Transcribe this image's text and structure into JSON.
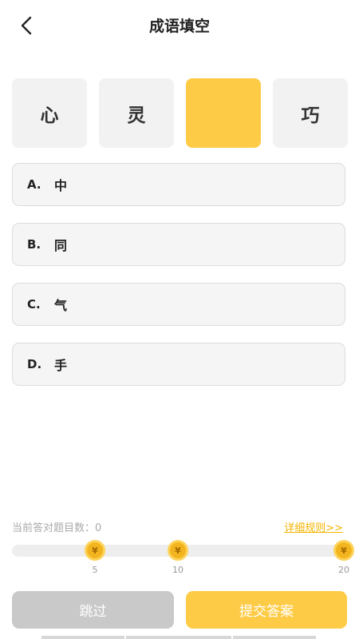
{
  "header": {
    "title": "成语填空",
    "back_icon": "chevron-left-icon"
  },
  "idiom": {
    "chars": [
      "心",
      "灵",
      "",
      "巧"
    ],
    "blank_color": "#fdcb46"
  },
  "options": [
    {
      "letter": "A.",
      "text": "中"
    },
    {
      "letter": "B.",
      "text": "同"
    },
    {
      "letter": "C.",
      "text": "气"
    },
    {
      "letter": "D.",
      "text": "手"
    }
  ],
  "progress": {
    "label": "当前答对题目数：0",
    "rules_link": "详细规则>>",
    "coin_symbol": "¥",
    "milestones": [
      "5",
      "10",
      "20"
    ],
    "accent": "#fdcb46"
  },
  "actions": {
    "skip_label": "跳过",
    "submit_label": "提交答案"
  }
}
